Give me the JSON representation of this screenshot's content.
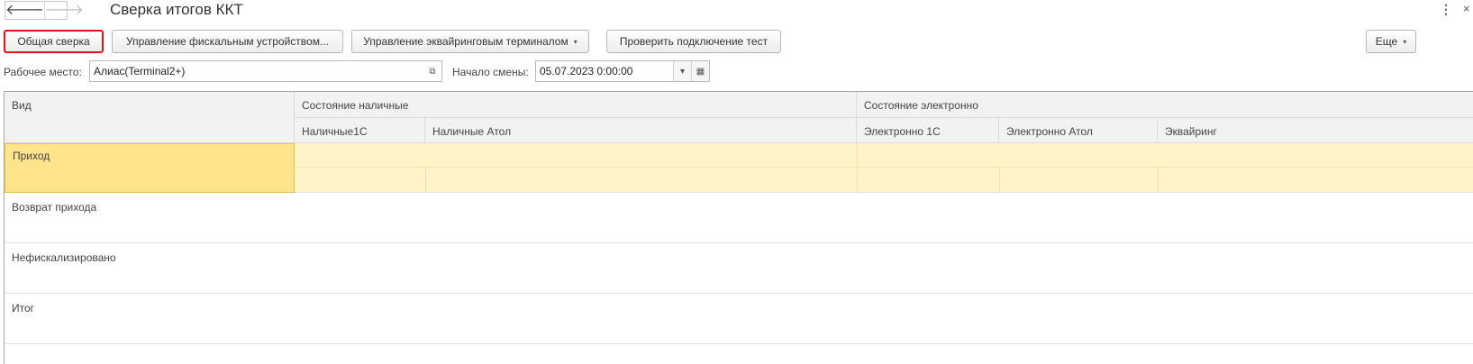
{
  "window": {
    "title": "Сверка итогов ККТ",
    "menu_icon": "⋮",
    "close_icon": "×"
  },
  "nav": {
    "back_icon": "🡐",
    "forward_icon": "🡒"
  },
  "toolbar": {
    "general_reconciliation": "Общая сверка",
    "fiscal_device": "Управление фискальным устройством...",
    "acquiring_terminal": "Управление эквайринговым терминалом",
    "check_connection": "Проверить подключение тест",
    "more": "Еще",
    "dropdown_icon": "▾"
  },
  "filters": {
    "workplace_label": "Рабочее место:",
    "workplace_value": "Алиас(Terminal2+)",
    "open_icon": "⧉",
    "shift_start_label": "Начало смены:",
    "shift_start_value": "05.07.2023  0:00:00",
    "calendar_icon": "▦"
  },
  "table": {
    "col_kind": "Вид",
    "group_cash": "Состояние наличные",
    "group_electronic": "Состояние электронно",
    "columns": [
      "Наличные1С",
      "Наличные Атол",
      "Электронно 1С",
      "Электронно Атол",
      "Эквайринг"
    ],
    "rows": [
      "Приход",
      "Возврат прихода",
      "Нефискализировано",
      "Итог"
    ]
  }
}
